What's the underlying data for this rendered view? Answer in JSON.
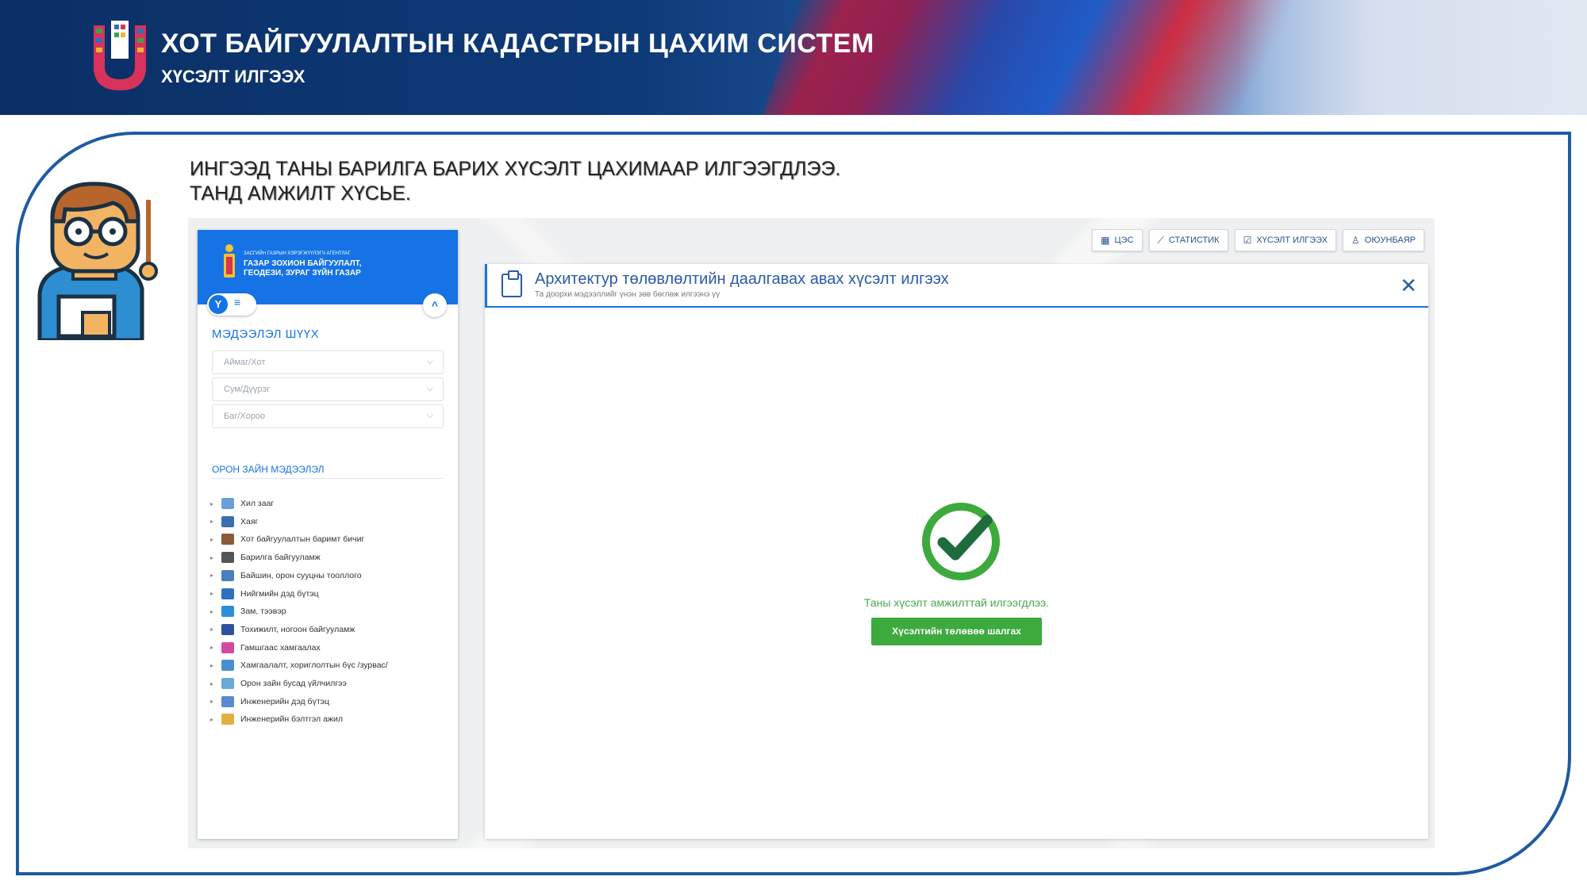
{
  "banner": {
    "title": "ХОТ БАЙГУУЛАЛТЫН КАДАСТРЫН ЦАХИМ СИСТЕМ",
    "subtitle": "ХҮСЭЛТ ИЛГЭЭХ"
  },
  "message": {
    "line1": "ИНГЭЭД ТАНЫ БАРИЛГА БАРИХ ХҮСЭЛТ ЦАХИМААР ИЛГЭЭГДЛЭЭ.",
    "line2": "ТАНД АМЖИЛТ ХҮСЬЕ."
  },
  "topnav": [
    {
      "icon": "grid-icon",
      "label": "ЦЭС"
    },
    {
      "icon": "chart-icon",
      "label": "СТАТИСТИК"
    },
    {
      "icon": "checkbox-icon",
      "label": "ХҮСЭЛТ ИЛГЭЭХ"
    },
    {
      "icon": "user-icon",
      "label": "ОЮУНБАЯР"
    }
  ],
  "sidebar": {
    "agency": "ЗАСГИЙН ГАЗРЫН ХЭРЭГЖҮҮЛЭГЧ АГЕНТЛАГ",
    "org_line1": "ГАЗАР ЗОХИОН БАЙГУУЛАЛТ,",
    "org_line2": "ГЕОДЕЗИ, ЗУРАГ ЗҮЙН ГАЗАР",
    "toggle_filter": "Y",
    "toggle_list": "≡",
    "search_title": "МЭДЭЭЛЭЛ ШҮҮХ",
    "selects": [
      {
        "placeholder": "Аймаг/Хот"
      },
      {
        "placeholder": "Сум/Дүүрэг"
      },
      {
        "placeholder": "Баг/Хороо"
      }
    ],
    "layers_title": "ОРОН ЗАЙН МЭДЭЭЛЭЛ",
    "layers": [
      {
        "label": "Хил зааг",
        "color": "#6aa0d8"
      },
      {
        "label": "Хаяг",
        "color": "#3b6db0"
      },
      {
        "label": "Хот байгуулалтын баримт бичиг",
        "color": "#8a5a3a"
      },
      {
        "label": "Барилга байгууламж",
        "color": "#555555"
      },
      {
        "label": "Байшин, орон сууцны тооллого",
        "color": "#4a7fbf"
      },
      {
        "label": "Нийгмийн дэд бүтэц",
        "color": "#2f6fc0"
      },
      {
        "label": "Зам, тээвэр",
        "color": "#2a8fd8"
      },
      {
        "label": "Тохижилт, ногоон байгууламж",
        "color": "#2f4fa0"
      },
      {
        "label": "Гамшгаас хамгаалах",
        "color": "#d04aa0"
      },
      {
        "label": "Хамгаалалт, хориглолтын бүс /зурвас/",
        "color": "#4a8fd0"
      },
      {
        "label": "Орон зайн бусад үйлчилгээ",
        "color": "#6aaad8"
      },
      {
        "label": "Инженерийн дэд бүтэц",
        "color": "#5a8ad0"
      },
      {
        "label": "Инженерийн бэлтгэл ажил",
        "color": "#e0b040"
      }
    ]
  },
  "panel": {
    "title": "Архитектур төлөвлөлтийн даалгавах авах хүсэлт илгээх",
    "subtitle": "Та доорхи мэдээллийг үнэн зөв бөглөж илгээнэ үү",
    "close": "✕",
    "success_text": "Таны хүсэлт амжилттай илгээгдлээ.",
    "status_button": "Хүсэлтийн төлөвөө шалгах"
  },
  "colors": {
    "banner": "#0b2f66",
    "accent": "#1673e6",
    "success": "#3daa3d",
    "frame": "#1e5aa3"
  }
}
